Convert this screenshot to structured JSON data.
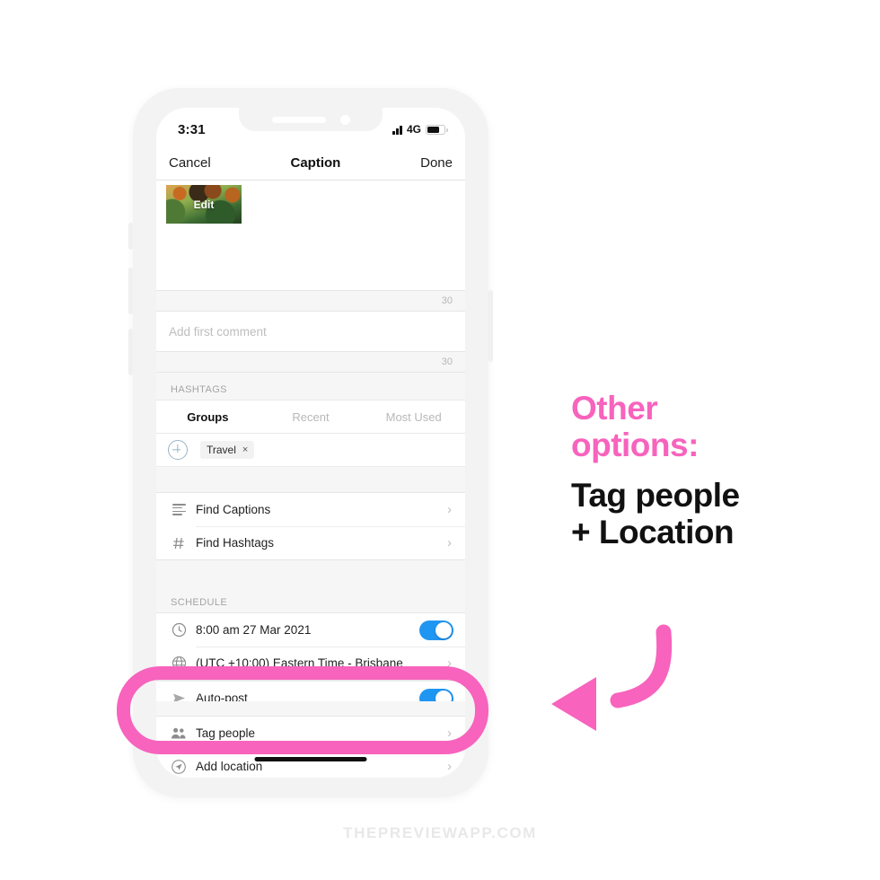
{
  "phone": {
    "status_bar": {
      "time": "3:31",
      "network": "4G",
      "signal_icon": "signal-bars-icon",
      "battery_icon": "battery-icon"
    },
    "nav_bar": {
      "cancel_label": "Cancel",
      "title": "Caption",
      "done_label": "Done"
    },
    "caption": {
      "thumbnail_edit_label": "Edit",
      "caption_counter": "30",
      "comment_placeholder": "Add first comment",
      "comment_counter": "30"
    },
    "hashtags": {
      "section_label": "HASHTAGS",
      "tabs": [
        {
          "label": "Groups",
          "active": true
        },
        {
          "label": "Recent",
          "active": false
        },
        {
          "label": "Most Used",
          "active": false
        }
      ],
      "add_icon": "plus-circle-icon",
      "chips": [
        {
          "label": "Travel",
          "remove": "×"
        }
      ]
    },
    "find_rows": [
      {
        "icon": "text-lines-icon",
        "label": "Find Captions",
        "accessory": "›"
      },
      {
        "icon": "hash-icon",
        "label": "Find Hashtags",
        "accessory": "›"
      }
    ],
    "schedule": {
      "section_label": "SCHEDULE",
      "rows": [
        {
          "icon": "clock-icon",
          "label": "8:00 am  27 Mar 2021",
          "accessory": "toggle",
          "toggle_on": true
        },
        {
          "icon": "globe-icon",
          "label": "(UTC +10:00) Eastern Time - Brisbane",
          "accessory": "›"
        },
        {
          "icon": "send-icon",
          "label": "Auto-post",
          "accessory": "toggle",
          "toggle_on": true
        }
      ]
    },
    "options_rows": [
      {
        "icon": "people-icon",
        "label": "Tag people",
        "accessory": "›"
      },
      {
        "icon": "location-arrow-icon",
        "label": "Add location",
        "accessory": "›"
      }
    ]
  },
  "annotation": {
    "pink_line_1": "Other",
    "pink_line_2": "options:",
    "black_line_1": "Tag people",
    "black_line_2": "+ Location",
    "arrow_icon": "curved-arrow-left-icon"
  },
  "watermark": "THEPREVIEWAPP.COM",
  "colors": {
    "accent_pink": "#f763bd",
    "toggle_blue": "#2096f3",
    "frame_gray": "#f3f3f3"
  }
}
